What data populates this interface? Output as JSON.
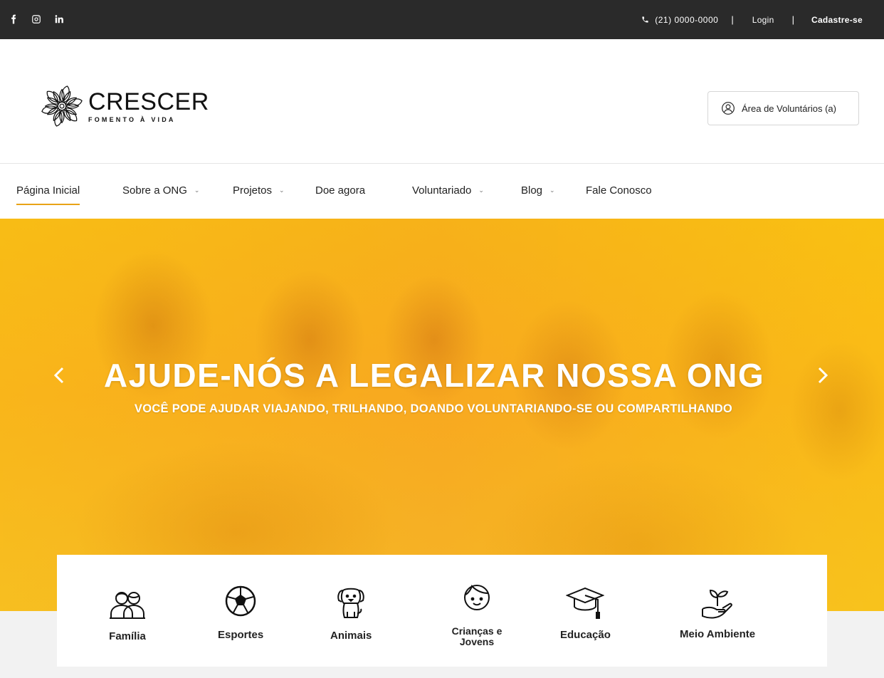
{
  "topbar": {
    "social": [
      {
        "name": "facebook-icon"
      },
      {
        "name": "instagram-icon"
      },
      {
        "name": "linkedin-icon"
      }
    ],
    "phone": "(21) 0000-0000",
    "separator": "|",
    "login": "Login",
    "signup": "Cadastre-se"
  },
  "header": {
    "brand": "CRESCER",
    "tagline": "FOMENTO À VIDA",
    "volunteer_button": "Área de Voluntários (a)"
  },
  "nav": {
    "items": [
      {
        "label": "Página Inicial",
        "active": true,
        "dropdown": false
      },
      {
        "label": "Sobre a ONG",
        "active": false,
        "dropdown": true
      },
      {
        "label": "Projetos",
        "active": false,
        "dropdown": true
      },
      {
        "label": "Doe agora",
        "active": false,
        "dropdown": false
      },
      {
        "label": "Voluntariado",
        "active": false,
        "dropdown": true
      },
      {
        "label": "Blog",
        "active": false,
        "dropdown": true
      },
      {
        "label": "Fale Conosco",
        "active": false,
        "dropdown": false
      }
    ],
    "chevron": "⌄",
    "accent": "#e8a317"
  },
  "hero": {
    "title": "AJUDE-NÓS A LEGALIZAR NOSSA ONG",
    "subtitle": "VOCÊ PODE AJUDAR VIAJANDO, TRILHANDO, DOANDO VOLUNTARIANDO-SE OU COMPARTILHANDO",
    "overlay_color": "#f7b21d"
  },
  "categories": {
    "items": [
      {
        "label": "Família",
        "icon": "family-icon"
      },
      {
        "label": "Esportes",
        "icon": "soccer-ball-icon"
      },
      {
        "label": "Animais",
        "icon": "dog-icon"
      },
      {
        "label": "Crianças e Jovens",
        "icon": "child-icon"
      },
      {
        "label": "Educação",
        "icon": "graduation-cap-icon"
      },
      {
        "label": "Meio Ambiente",
        "icon": "plant-hand-icon"
      }
    ]
  }
}
